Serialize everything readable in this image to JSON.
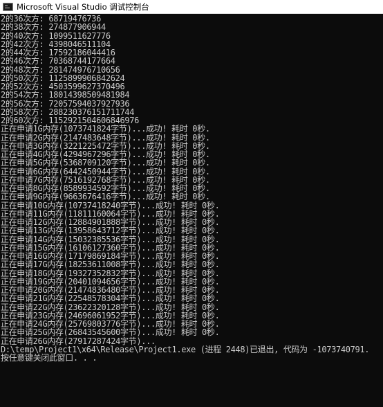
{
  "window": {
    "title": "Microsoft Visual Studio 调试控制台",
    "icon": "console-app-icon"
  },
  "console": {
    "colors": {
      "background": "#0c0c0c",
      "text": "#cccccc"
    },
    "lines": [
      "2的36次方: 68719476736",
      "2的38次方: 274877906944",
      "2的40次方: 1099511627776",
      "2的42次方: 4398046511104",
      "2的44次方: 17592186044416",
      "2的46次方: 70368744177664",
      "2的48次方: 281474976710656",
      "2的50次方: 1125899906842624",
      "2的52次方: 4503599627370496",
      "2的54次方: 18014398509481984",
      "2的56次方: 72057594037927936",
      "2的58次方: 288230376151711744",
      "2的60次方: 1152921504606846976",
      "正在申请1G内存(1073741824字节)...成功! 耗时 0秒.",
      "正在申请2G内存(2147483648字节)...成功! 耗时 0秒.",
      "正在申请3G内存(3221225472字节)...成功! 耗时 0秒.",
      "正在申请4G内存(4294967296字节)...成功! 耗时 0秒.",
      "正在申请5G内存(5368709120字节)...成功! 耗时 0秒.",
      "正在申请6G内存(6442450944字节)...成功! 耗时 0秒.",
      "正在申请7G内存(7516192768字节)...成功! 耗时 0秒.",
      "正在申请8G内存(8589934592字节)...成功! 耗时 0秒.",
      "正在申请9G内存(9663676416字节)...成功! 耗时 0秒.",
      "正在申请10G内存(10737418240字节)...成功! 耗时 0秒.",
      "正在申请11G内存(11811160064字节)...成功! 耗时 0秒.",
      "正在申请12G内存(12884901888字节)...成功! 耗时 0秒.",
      "正在申请13G内存(13958643712字节)...成功! 耗时 0秒.",
      "正在申请14G内存(15032385536字节)...成功! 耗时 0秒.",
      "正在申请15G内存(16106127360字节)...成功! 耗时 0秒.",
      "正在申请16G内存(17179869184字节)...成功! 耗时 0秒.",
      "正在申请17G内存(18253611008字节)...成功! 耗时 0秒.",
      "正在申请18G内存(19327352832字节)...成功! 耗时 0秒.",
      "正在申请19G内存(20401094656字节)...成功! 耗时 0秒.",
      "正在申请20G内存(21474836480字节)...成功! 耗时 0秒.",
      "正在申请21G内存(22548578304字节)...成功! 耗时 0秒.",
      "正在申请22G内存(23622320128字节)...成功! 耗时 0秒.",
      "正在申请23G内存(24696061952字节)...成功! 耗时 0秒.",
      "正在申请24G内存(25769803776字节)...成功! 耗时 0秒.",
      "正在申请25G内存(26843545600字节)...成功! 耗时 0秒.",
      "正在申请26G内存(27917287424字节)...",
      "D:\\temp\\Project1\\x64\\Release\\Project1.exe (进程 2448)已退出, 代码为 -1073740791.",
      "按任意键关闭此窗口. . ."
    ]
  }
}
